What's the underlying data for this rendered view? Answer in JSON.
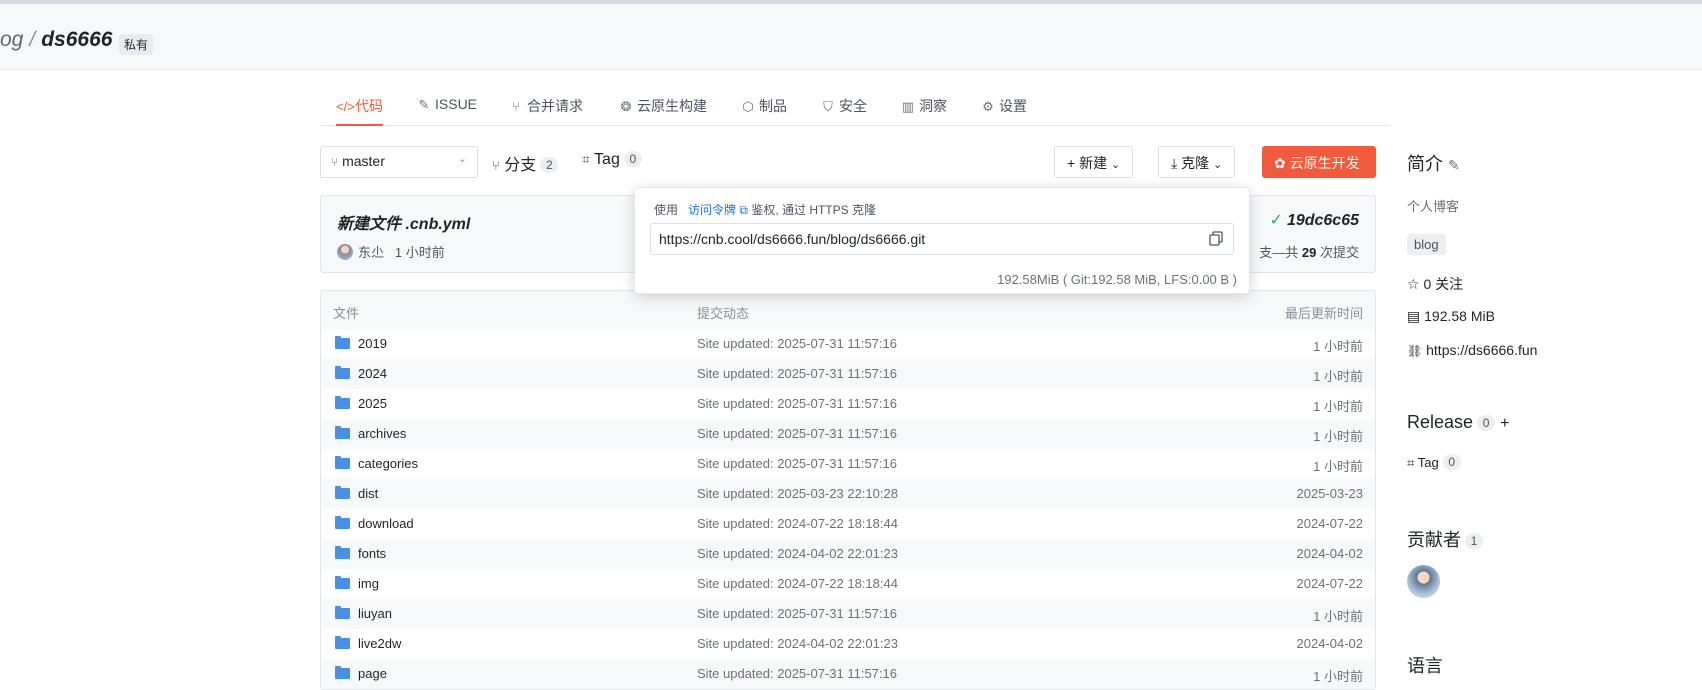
{
  "header": {
    "crumb_prefix": "og",
    "crumb_sep": "/",
    "repo": "ds6666",
    "visibility": "私有"
  },
  "tabs": [
    {
      "icon": "code-icon",
      "glyph": "</>",
      "label": "代码",
      "active": true
    },
    {
      "icon": "issue-icon",
      "glyph": "✎",
      "label": "ISSUE"
    },
    {
      "icon": "merge-icon",
      "glyph": "⑂",
      "label": "合并请求"
    },
    {
      "icon": "cloud-build-icon",
      "glyph": "❂",
      "label": "云原生构建"
    },
    {
      "icon": "package-icon",
      "glyph": "⬡",
      "label": "制品"
    },
    {
      "icon": "shield-icon",
      "glyph": "⛉",
      "label": "安全"
    },
    {
      "icon": "insight-icon",
      "glyph": "▥",
      "label": "洞察"
    },
    {
      "icon": "settings-icon",
      "glyph": "⚙",
      "label": "设置"
    }
  ],
  "toolbar": {
    "branch": "master",
    "branches_label": "分支",
    "branches_count": "2",
    "tags_label": "Tag",
    "tags_count": "0",
    "new_label": "新建",
    "clone_label": "克隆",
    "cloud_dev_label": "云原生开发"
  },
  "commit": {
    "title": "新建文件 .cnb.yml",
    "author": "东尐",
    "time": "1 小时前",
    "hash": "19dc6c65",
    "count_prefix": "支—共",
    "count": "29",
    "count_suffix": "次提交"
  },
  "clone_popover": {
    "prefix": "使用",
    "token_link": "访问令牌",
    "suffix": "鉴权, 通过 HTTPS 克隆",
    "url": "https://cnb.cool/ds6666.fun/blog/ds6666.git",
    "size": "192.58MiB ( Git:192.58 MiB, LFS:0.00 B )"
  },
  "files": {
    "headers": {
      "name": "文件",
      "message": "提交动态",
      "time": "最后更新时间"
    },
    "rows": [
      {
        "name": "2019",
        "message": "Site updated: 2025-07-31 11:57:16",
        "time": "1 小时前"
      },
      {
        "name": "2024",
        "message": "Site updated: 2025-07-31 11:57:16",
        "time": "1 小时前"
      },
      {
        "name": "2025",
        "message": "Site updated: 2025-07-31 11:57:16",
        "time": "1 小时前"
      },
      {
        "name": "archives",
        "message": "Site updated: 2025-07-31 11:57:16",
        "time": "1 小时前"
      },
      {
        "name": "categories",
        "message": "Site updated: 2025-07-31 11:57:16",
        "time": "1 小时前"
      },
      {
        "name": "dist",
        "message": "Site updated: 2025-03-23 22:10:28",
        "time": "2025-03-23"
      },
      {
        "name": "download",
        "message": "Site updated: 2024-07-22 18:18:44",
        "time": "2024-07-22"
      },
      {
        "name": "fonts",
        "message": "Site updated: 2024-04-02 22:01:23",
        "time": "2024-04-02"
      },
      {
        "name": "img",
        "message": "Site updated: 2024-07-22 18:18:44",
        "time": "2024-07-22"
      },
      {
        "name": "liuyan",
        "message": "Site updated: 2025-07-31 11:57:16",
        "time": "1 小时前"
      },
      {
        "name": "live2dw",
        "message": "Site updated: 2024-04-02 22:01:23",
        "time": "2024-04-02"
      },
      {
        "name": "page",
        "message": "Site updated: 2025-07-31 11:57:16",
        "time": "1 小时前"
      }
    ]
  },
  "sidebar": {
    "intro_title": "简介",
    "intro_text": "个人博客",
    "topic": "blog",
    "stars": "0 关注",
    "size": "192.58 MiB",
    "website": "https://ds6666.fun",
    "release_title": "Release",
    "release_count": "0",
    "release_tag_label": "Tag",
    "release_tag_count": "0",
    "contributors_title": "贡献者",
    "contributors_count": "1",
    "language_title": "语言"
  }
}
